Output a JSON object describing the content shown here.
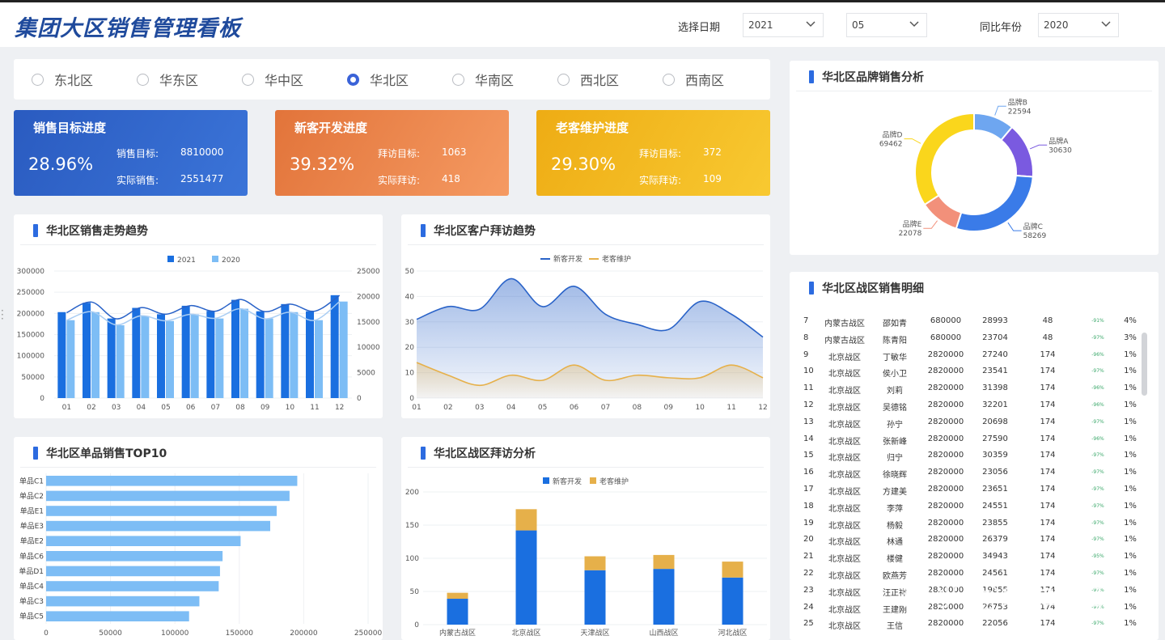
{
  "header": {
    "title": "集团大区销售管理看板",
    "date_label": "选择日期",
    "year_value": "2021",
    "month_value": "05",
    "yoy_label": "同比年份",
    "yoy_value": "2020"
  },
  "regions": [
    {
      "label": "东北区",
      "selected": false
    },
    {
      "label": "华东区",
      "selected": false
    },
    {
      "label": "华中区",
      "selected": false
    },
    {
      "label": "华北区",
      "selected": true
    },
    {
      "label": "华南区",
      "selected": false
    },
    {
      "label": "西北区",
      "selected": false
    },
    {
      "label": "西南区",
      "selected": false
    }
  ],
  "kpis": [
    {
      "title": "销售目标进度",
      "percent": "28.96%",
      "label1": "销售目标:",
      "value1": "8810000",
      "label2": "实际销售:",
      "value2": "2551477",
      "color": "#2f63c8"
    },
    {
      "title": "新客开发进度",
      "percent": "39.32%",
      "label1": "拜访目标:",
      "value1": "1063",
      "label2": "实际拜访:",
      "value2": "418",
      "color": "#ec8448"
    },
    {
      "title": "老客维护进度",
      "percent": "29.30%",
      "label1": "拜访目标:",
      "value1": "372",
      "label2": "实际拜访:",
      "value2": "109",
      "color": "#f3b81d"
    }
  ],
  "panels": {
    "sales_trend": "华北区销售走势趋势",
    "visit_trend": "华北区客户拜访趋势",
    "top10": "华北区单品销售TOP10",
    "zone_visit": "华北区战区拜访分析",
    "brand": "华北区品牌销售分析",
    "detail": "华北区战区销售明细"
  },
  "chart_data": [
    {
      "id": "sales_trend",
      "type": "bar",
      "categories": [
        "01",
        "02",
        "03",
        "04",
        "05",
        "06",
        "07",
        "08",
        "09",
        "10",
        "11",
        "12"
      ],
      "series": [
        {
          "name": "2021",
          "values": [
            203000,
            225000,
            188000,
            213000,
            198000,
            218000,
            206000,
            232000,
            205000,
            222000,
            205000,
            243000
          ],
          "color": "#1a6fe0"
        },
        {
          "name": "2020",
          "values": [
            184000,
            203000,
            172000,
            194000,
            182000,
            198000,
            188000,
            211000,
            188000,
            203000,
            184000,
            228000
          ],
          "color": "#7dbdf5"
        }
      ],
      "ylim": [
        0,
        300000
      ],
      "yticks": [
        "0",
        "50000",
        "100000",
        "150000",
        "200000",
        "250000",
        "300000"
      ],
      "y2lim": [
        0,
        25000
      ],
      "y2ticks": [
        "0",
        "5000",
        "10000",
        "15000",
        "20000",
        "25000"
      ],
      "lines": [
        [
          16800,
          18900,
          15600,
          17800,
          16500,
          18200,
          17100,
          19400,
          17000,
          18500,
          17100,
          20200
        ],
        [
          15300,
          17000,
          14400,
          16200,
          15200,
          16500,
          15700,
          17600,
          15600,
          16900,
          15300,
          19000
        ]
      ]
    },
    {
      "id": "visit_trend",
      "type": "area",
      "categories": [
        "01",
        "02",
        "03",
        "04",
        "05",
        "06",
        "07",
        "08",
        "09",
        "10",
        "11",
        "12"
      ],
      "series": [
        {
          "name": "新客开发",
          "values": [
            31,
            36,
            35,
            47,
            36,
            44,
            33,
            29,
            27,
            38,
            33,
            24
          ],
          "color": "#2a63c8"
        },
        {
          "name": "老客维护",
          "values": [
            14,
            9,
            5,
            9,
            7,
            13,
            7,
            9,
            8,
            8,
            13,
            8
          ],
          "color": "#e6b04a"
        }
      ],
      "ylim": [
        0,
        50
      ],
      "yticks": [
        "0",
        "10",
        "20",
        "30",
        "40",
        "50"
      ]
    },
    {
      "id": "top10",
      "type": "bar",
      "orientation": "horizontal",
      "categories": [
        "单品C1",
        "单品C2",
        "单品E1",
        "单品E3",
        "单品E2",
        "单品C6",
        "单品D1",
        "单品C4",
        "单品C3",
        "单品C5"
      ],
      "values": [
        195000,
        189000,
        179000,
        174000,
        151000,
        137000,
        135000,
        134000,
        119000,
        111000
      ],
      "xlim": [
        0,
        250000
      ],
      "xticks": [
        "0",
        "50000",
        "100000",
        "150000",
        "200000",
        "250000"
      ],
      "color": "#7dbdf5"
    },
    {
      "id": "zone_visit",
      "type": "bar",
      "stacked": true,
      "categories": [
        "内蒙古战区",
        "北京战区",
        "天津战区",
        "山西战区",
        "河北战区"
      ],
      "series": [
        {
          "name": "新客开发",
          "values": [
            39,
            142,
            82,
            84,
            71
          ],
          "color": "#1a6fe0"
        },
        {
          "name": "老客维护",
          "values": [
            9,
            32,
            21,
            21,
            24
          ],
          "color": "#e6b04a"
        }
      ],
      "ylim": [
        0,
        200
      ],
      "yticks": [
        "0",
        "50",
        "100",
        "150",
        "200"
      ]
    },
    {
      "id": "brand",
      "type": "pie",
      "donut": true,
      "slices": [
        {
          "label": "品牌B",
          "value": 22594,
          "color": "#6ea6f0"
        },
        {
          "label": "品牌A",
          "value": 30630,
          "color": "#7a5ae0"
        },
        {
          "label": "品牌C",
          "value": 58269,
          "color": "#3a7be8"
        },
        {
          "label": "品牌E",
          "value": 22078,
          "color": "#f2907a"
        },
        {
          "label": "品牌D",
          "value": 69462,
          "color": "#fad61c"
        }
      ]
    }
  ],
  "detail_rows": [
    [
      "7",
      "内蒙古战区",
      "邵如青",
      "680000",
      "28993",
      "48",
      "-91%",
      "4%"
    ],
    [
      "8",
      "内蒙古战区",
      "陈青阳",
      "680000",
      "23704",
      "48",
      "-97%",
      "3%"
    ],
    [
      "9",
      "北京战区",
      "丁敏华",
      "2820000",
      "27240",
      "174",
      "-96%",
      "1%"
    ],
    [
      "10",
      "北京战区",
      "侯小卫",
      "2820000",
      "23541",
      "174",
      "-97%",
      "1%"
    ],
    [
      "11",
      "北京战区",
      "刘莉",
      "2820000",
      "31398",
      "174",
      "-96%",
      "1%"
    ],
    [
      "12",
      "北京战区",
      "吴德铭",
      "2820000",
      "32201",
      "174",
      "-96%",
      "1%"
    ],
    [
      "13",
      "北京战区",
      "孙宁",
      "2820000",
      "20698",
      "174",
      "-97%",
      "1%"
    ],
    [
      "14",
      "北京战区",
      "张新峰",
      "2820000",
      "27590",
      "174",
      "-96%",
      "1%"
    ],
    [
      "15",
      "北京战区",
      "归宁",
      "2820000",
      "30359",
      "174",
      "-97%",
      "1%"
    ],
    [
      "16",
      "北京战区",
      "徐晓辉",
      "2820000",
      "23056",
      "174",
      "-97%",
      "1%"
    ],
    [
      "17",
      "北京战区",
      "方建美",
      "2820000",
      "23651",
      "174",
      "-97%",
      "1%"
    ],
    [
      "18",
      "北京战区",
      "李萍",
      "2820000",
      "24551",
      "174",
      "-97%",
      "1%"
    ],
    [
      "19",
      "北京战区",
      "杨毅",
      "2820000",
      "23855",
      "174",
      "-97%",
      "1%"
    ],
    [
      "20",
      "北京战区",
      "林通",
      "2820000",
      "26379",
      "174",
      "-97%",
      "1%"
    ],
    [
      "21",
      "北京战区",
      "楼健",
      "2820000",
      "34943",
      "174",
      "-95%",
      "1%"
    ],
    [
      "22",
      "北京战区",
      "欧燕芳",
      "2820000",
      "24561",
      "174",
      "-97%",
      "1%"
    ],
    [
      "23",
      "北京战区",
      "汪正祥",
      "2820000",
      "19855",
      "174",
      "-97%",
      "1%"
    ],
    [
      "24",
      "北京战区",
      "王建刚",
      "2820000",
      "26753",
      "174",
      "-97%",
      "1%"
    ],
    [
      "25",
      "北京战区",
      "王信",
      "2820000",
      "22056",
      "174",
      "-97%",
      "1%"
    ]
  ],
  "watermark": "知乎 @miao君"
}
